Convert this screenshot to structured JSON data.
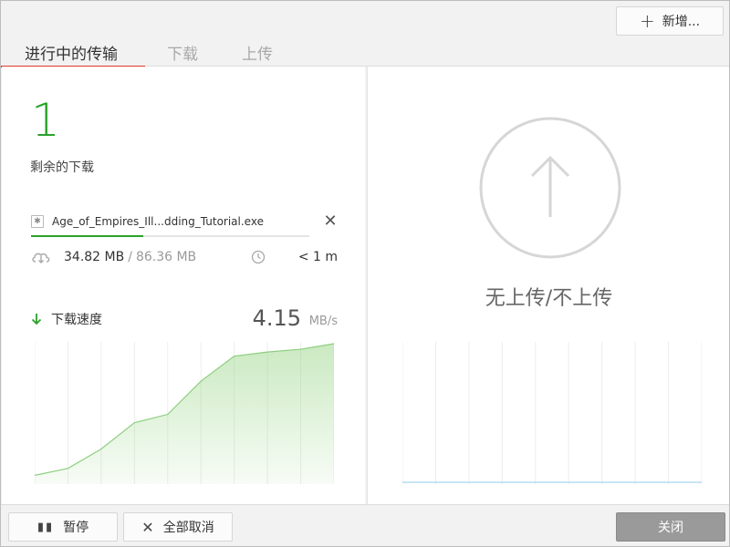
{
  "header": {
    "new_button_label": "新增...",
    "tabs": [
      {
        "label": "进行中的传输",
        "active": true
      },
      {
        "label": "下载",
        "active": false
      },
      {
        "label": "上传",
        "active": false
      }
    ]
  },
  "download": {
    "remaining_count": "1",
    "remaining_label": "剩余的下载",
    "file_name": "Age_of_Empires_Ill...dding_Tutorial.exe",
    "downloaded": "34.82 MB",
    "separator": "/",
    "total": "86.36 MB",
    "progress": 0.4032,
    "eta": "< 1 m",
    "speed_label": "下载速度",
    "speed_value": "4.15",
    "speed_unit": "MB/s",
    "speed_history": [
      0.05,
      0.1,
      0.24,
      0.43,
      0.49,
      0.73,
      0.91,
      0.94,
      0.96,
      1.0
    ]
  },
  "upload": {
    "empty_message": "无上传/不上传",
    "speed_history": [
      0,
      0,
      0,
      0,
      0,
      0,
      0,
      0,
      0,
      0
    ]
  },
  "footer": {
    "pause_label": "暂停",
    "cancel_all_label": "全部取消",
    "close_label": "关闭"
  },
  "colors": {
    "accent_green": "#2aa22a",
    "tab_underline": "#e0392b",
    "upload_line": "#a8d4ef"
  }
}
